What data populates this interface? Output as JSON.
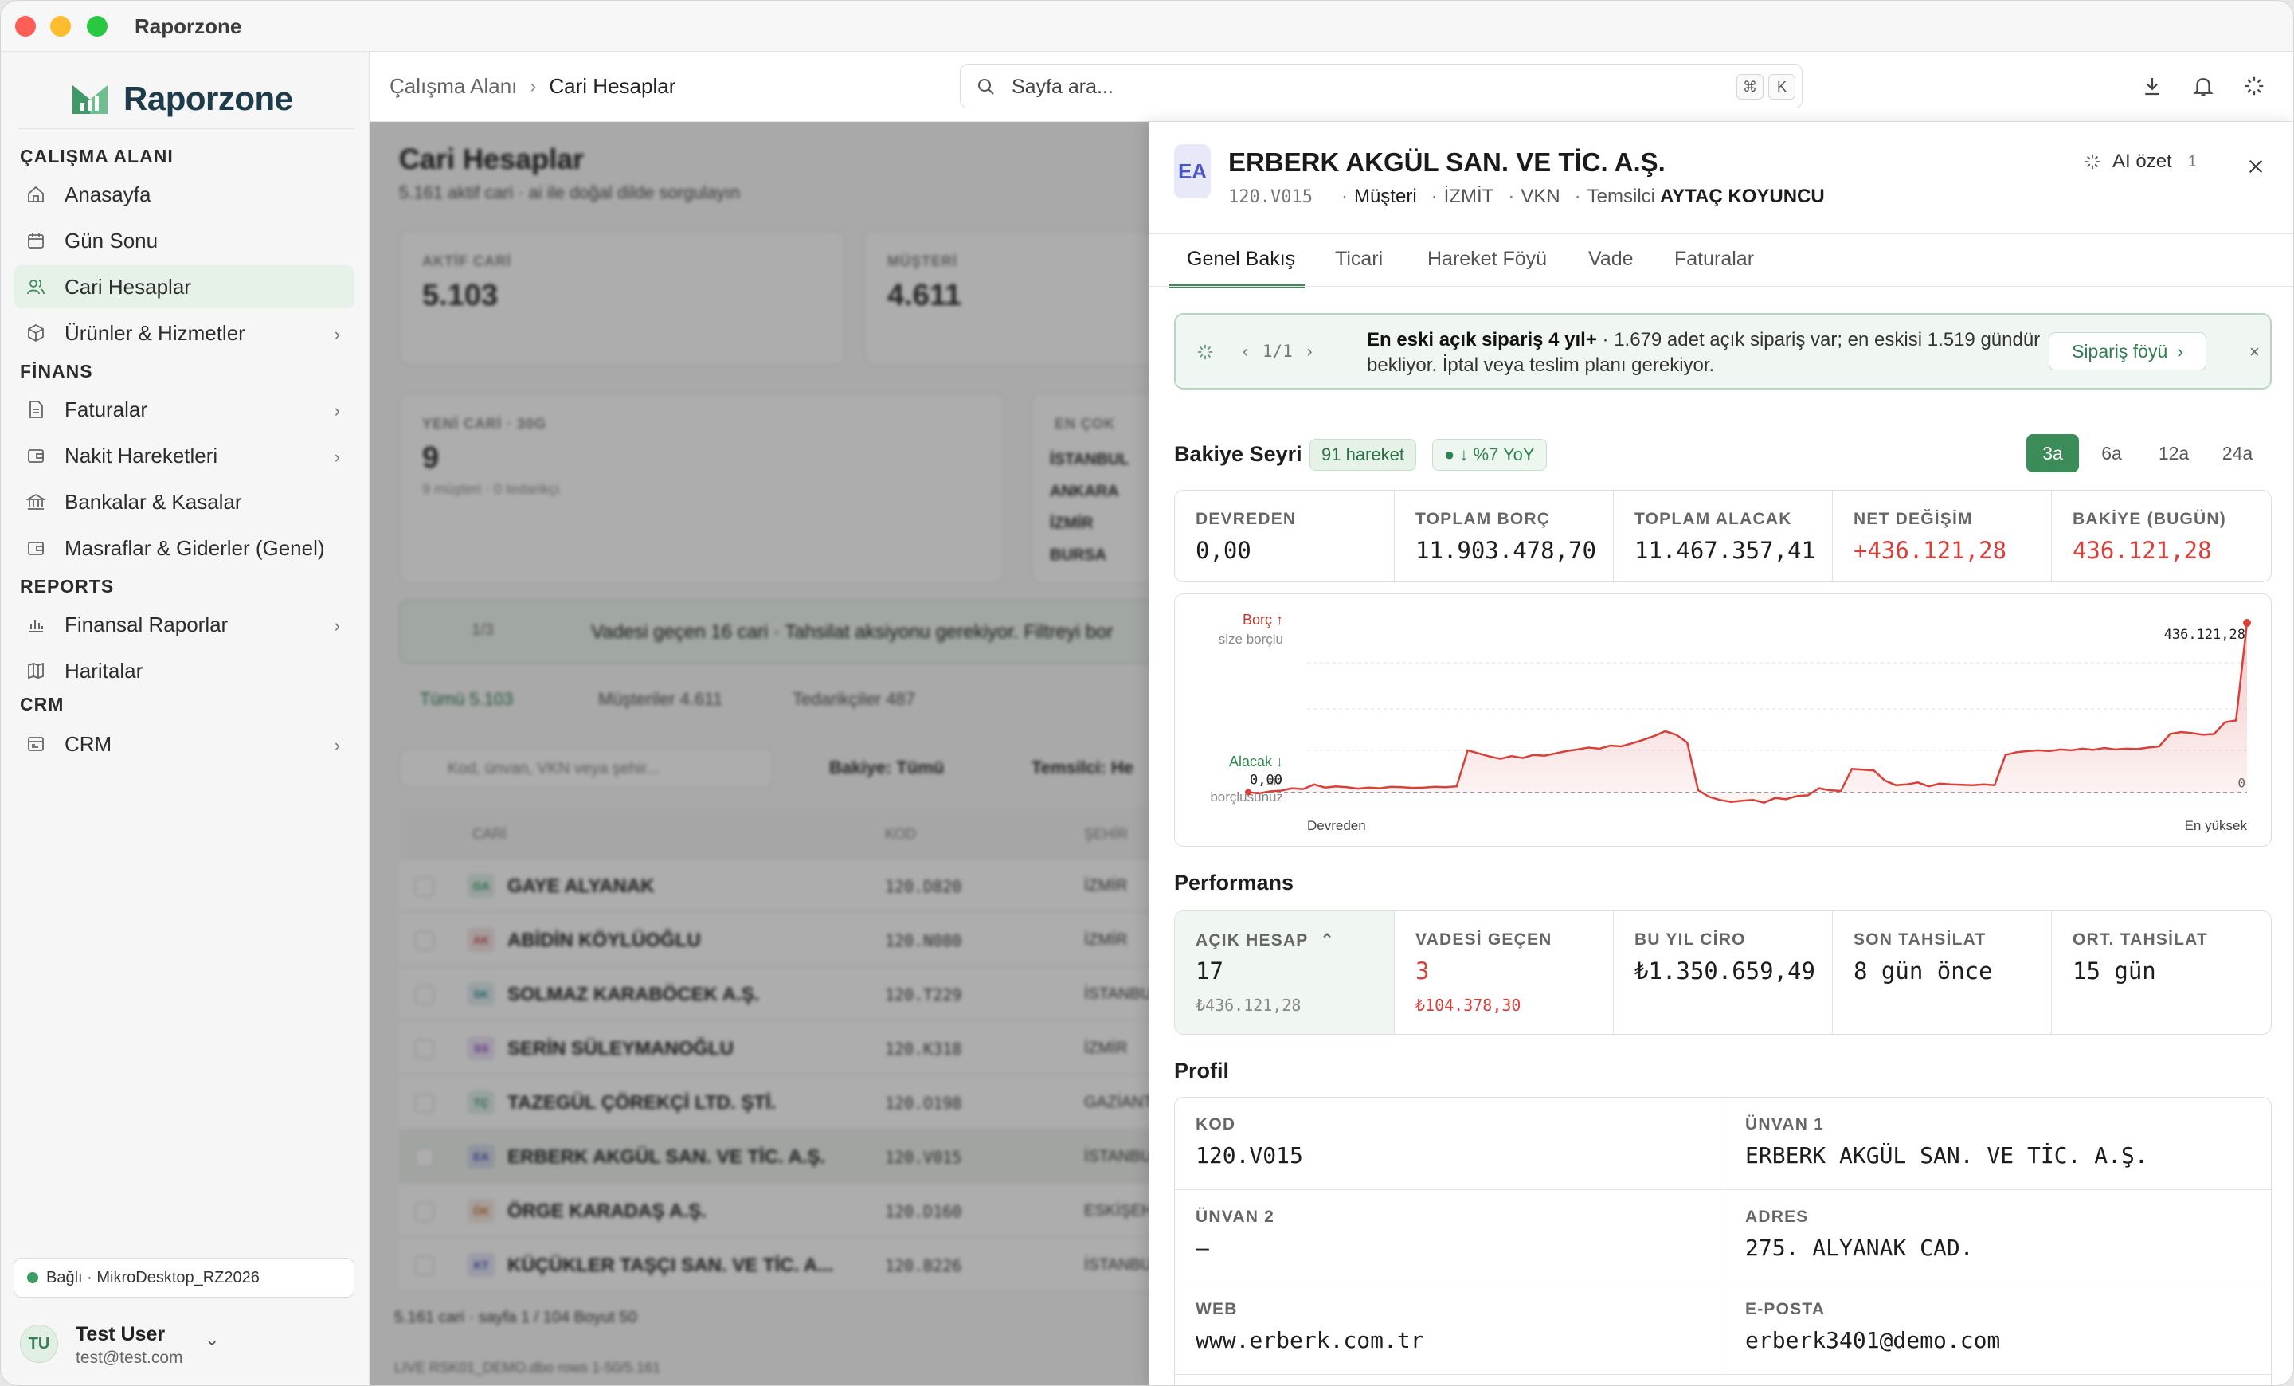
{
  "window": {
    "title": "Raporzone"
  },
  "sidebar": {
    "brand": "Raporzone",
    "sections": [
      {
        "label": "ÇALIŞMA ALANI"
      },
      {
        "label": "FİNANS"
      },
      {
        "label": "REPORTS"
      },
      {
        "label": "CRM"
      }
    ],
    "items": [
      {
        "label": "Anasayfa",
        "icon": "home-icon"
      },
      {
        "label": "Gün Sonu",
        "icon": "calendar-icon"
      },
      {
        "label": "Cari Hesaplar",
        "icon": "users-icon",
        "active": true
      },
      {
        "label": "Ürünler & Hizmetler",
        "icon": "box-icon"
      },
      {
        "label": "Faturalar",
        "icon": "file-icon"
      },
      {
        "label": "Nakit Hareketleri",
        "icon": "cash-icon"
      },
      {
        "label": "Bankalar & Kasalar",
        "icon": "bank-icon"
      },
      {
        "label": "Masraflar & Giderler (Genel)",
        "icon": "receipt-icon"
      },
      {
        "label": "Finansal Raporlar",
        "icon": "bar-chart-icon"
      },
      {
        "label": "Haritalar",
        "icon": "map-icon"
      },
      {
        "label": "CRM",
        "icon": "crm-icon"
      }
    ],
    "connection": "Bağlı · MikroDesktop_RZ2026",
    "user": {
      "initials": "TU",
      "name": "Test User",
      "email": "test@test.com"
    }
  },
  "topbar": {
    "breadcrumb": [
      "Çalışma Alanı",
      "Cari Hesaplar"
    ],
    "search_placeholder": "Sayfa ara...",
    "shortcut": [
      "⌘",
      "K"
    ]
  },
  "background": {
    "title": "Cari Hesaplar",
    "subtitle": "5.161 aktif cari · ai ile doğal dilde sorgulayın",
    "cards": [
      {
        "label": "AKTİF CARİ",
        "value": "5.103"
      },
      {
        "label": "MÜŞTERİ",
        "value": "4.611"
      },
      {
        "label": "YENİ CARİ · 30G",
        "value": "9",
        "sub": "9 müşteri · 0 tedarikçi"
      },
      {
        "label": "EN ÇOK",
        "cities": [
          "İSTANBUL",
          "ANKARA",
          "İZMİR",
          "BURSA"
        ]
      }
    ],
    "banner": "Vadesi geçen 16 cari · Tahsilat aksiyonu gerekiyor. Filtreyi bor",
    "banner_pager": "1/3",
    "tabs": [
      "Tümü 5.103",
      "Müşteriler 4.611",
      "Tedarikçiler 487"
    ],
    "filter_placeholder": "Kod, ünvan, VKN veya şehir...",
    "filter_balance": "Bakiye: Tümü",
    "filter_rep": "Temsilci: He",
    "columns": [
      "CARİ",
      "KOD",
      "ŞEHİR"
    ],
    "rows": [
      {
        "abbr": "GA",
        "name": "GAYE ALYANAK",
        "code": "120.D820",
        "city": "İZMİR",
        "color": "#3a9a6a"
      },
      {
        "abbr": "AK",
        "name": "ABİDİN KÖYLÜOĞLU",
        "code": "120.N080",
        "city": "İZMİR",
        "color": "#c25a5a"
      },
      {
        "abbr": "SK",
        "name": "SOLMAZ KARABÖCEK A.Ş.",
        "code": "120.T229",
        "city": "İSTANBUL",
        "color": "#3a8a9a"
      },
      {
        "abbr": "SS",
        "name": "SERİN SÜLEYMANOĞLU",
        "code": "120.K318",
        "city": "İZMİR",
        "color": "#8a4ac2"
      },
      {
        "abbr": "TÇ",
        "name": "TAZEGÜL ÇÖREKÇİ LTD. ŞTİ.",
        "code": "120.O198",
        "city": "GAZİANTEP",
        "color": "#3a9a7a"
      },
      {
        "abbr": "EA",
        "name": "ERBERK AKGÜL SAN. VE TİC. A.Ş.",
        "code": "120.V015",
        "city": "İSTANBUL",
        "color": "#4c56c2"
      },
      {
        "abbr": "ÖK",
        "name": "ÖRGE KARADAŞ A.Ş.",
        "code": "120.D160",
        "city": "ESKİŞEHİR",
        "color": "#c27a3a"
      },
      {
        "abbr": "KT",
        "name": "KÜÇÜKLER TAŞÇI SAN. VE TİC. A...",
        "code": "120.B226",
        "city": "İSTANBUL",
        "color": "#4c56c2"
      }
    ],
    "footer": "5.161 cari · sayfa 1 / 104   Boyut   50",
    "status": "LIVE   RSK01_DEMO.dbo   rows 1-50/5.161"
  },
  "panel": {
    "avatar": "EA",
    "name": "ERBERK AKGÜL SAN. VE TİC. A.Ş.",
    "code": "120.V015",
    "type": "Müşteri",
    "city": "İZMİT",
    "vkn": "VKN",
    "rep_label": "Temsilci",
    "rep": "AYTAÇ KOYUNCU",
    "ai_label": "AI özet",
    "ai_count": "1",
    "tabs": [
      "Genel Bakış",
      "Ticari",
      "Hareket Föyü",
      "Vade",
      "Faturalar"
    ],
    "alert": {
      "pager": "1/1",
      "title": "En eski açık sipariş 4 yıl+",
      "text": " · 1.679 adet açık sipariş var; en eskisi 1.519 gündür bekliyor. İptal veya teslim planı gerekiyor.",
      "button": "Sipariş föyü"
    },
    "balance": {
      "title": "Bakiye Seyri",
      "moves_badge": "91 hareket",
      "yoy_badge": "● ↓ %7 YoY",
      "periods": [
        "3a",
        "6a",
        "12a",
        "24a"
      ],
      "active_period": "3a",
      "stats": [
        {
          "label": "DEVREDEN",
          "value": "0,00"
        },
        {
          "label": "TOPLAM BORÇ",
          "value": "11.903.478,70"
        },
        {
          "label": "TOPLAM ALACAK",
          "value": "11.467.357,41"
        },
        {
          "label": "NET DEĞİŞİM",
          "value": "+436.121,28",
          "color": "#d9403a"
        },
        {
          "label": "BAKİYE (BUGÜN)",
          "value": "436.121,28",
          "color": "#d9403a"
        }
      ]
    },
    "chart_data": {
      "type": "area",
      "borc_label": "Borç ↑",
      "borc_sub": "size borçlu",
      "alacak_label": "Alacak ↓",
      "alacak_sub": "siz borçlusunuz",
      "start_value_label": "0,00",
      "end_value_label": "436.121,28",
      "zero_label": "0",
      "x_start_label": "Devreden",
      "x_end_label": "En yüksek",
      "ylim": [
        -40000,
        436121.28
      ],
      "values": [
        0,
        -3000,
        2000,
        4000,
        10000,
        8000,
        20000,
        12000,
        15000,
        13000,
        9000,
        12000,
        10000,
        14000,
        13000,
        11000,
        12000,
        14000,
        13000,
        15000,
        108000,
        100000,
        92000,
        86000,
        93000,
        88000,
        96000,
        94000,
        100000,
        106000,
        110000,
        115000,
        112000,
        120000,
        118000,
        126000,
        135000,
        145000,
        157000,
        148000,
        128000,
        5000,
        -12000,
        -20000,
        -25000,
        -22000,
        -20000,
        -27000,
        -15000,
        -18000,
        -10000,
        -8000,
        10000,
        5000,
        3000,
        60000,
        58000,
        56000,
        30000,
        18000,
        20000,
        25000,
        15000,
        22000,
        20000,
        19000,
        18000,
        20000,
        18000,
        96000,
        103000,
        106000,
        108000,
        106000,
        110000,
        108000,
        112000,
        109000,
        114000,
        110000,
        112000,
        111000,
        115000,
        118000,
        150000,
        155000,
        152000,
        148000,
        150000,
        180000,
        185000,
        436121.28
      ]
    },
    "performance": {
      "title": "Performans",
      "stats": [
        {
          "label": "AÇIK HESAP",
          "value": "17",
          "sub": "₺436.121,28"
        },
        {
          "label": "VADESİ GEÇEN",
          "value": "3",
          "sub": "₺104.378,30",
          "color": "#d9403a"
        },
        {
          "label": "BU YIL CİRO",
          "value": "₺1.350.659,49"
        },
        {
          "label": "SON TAHSİLAT",
          "value": "8 gün önce"
        },
        {
          "label": "ORT. TAHSİLAT",
          "value": "15 gün"
        }
      ]
    },
    "profile": {
      "title": "Profil",
      "fields": [
        {
          "label": "KOD",
          "value": "120.V015"
        },
        {
          "label": "ÜNVAN 1",
          "value": "ERBERK AKGÜL SAN. VE TİC. A.Ş."
        },
        {
          "label": "ÜNVAN 2",
          "value": "—"
        },
        {
          "label": "ADRES",
          "value": "275. ALYANAK CAD."
        },
        {
          "label": "WEB",
          "value": "www.erberk.com.tr"
        },
        {
          "label": "E-POSTA",
          "value": "erberk3401@demo.com"
        }
      ]
    }
  }
}
